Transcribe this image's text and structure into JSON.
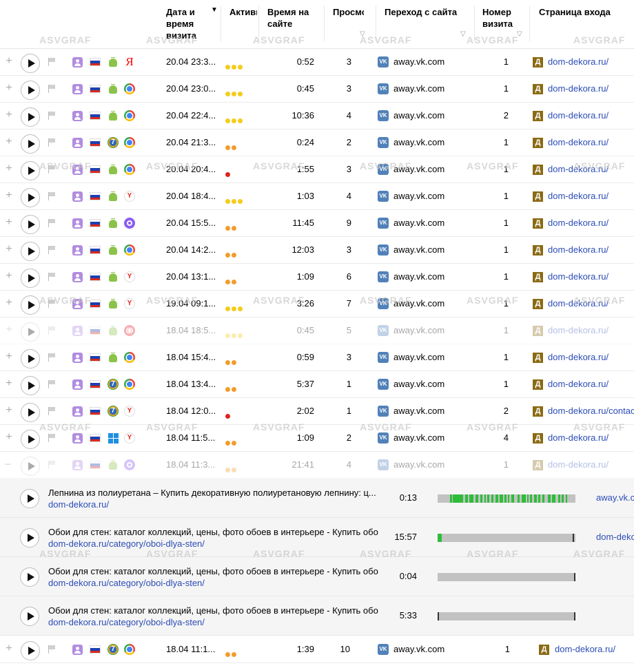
{
  "header": {
    "date": "Дата и время визита",
    "activity": "Активн",
    "duration": "Время на сайте",
    "views": "Просмо",
    "source": "Переход с сайта",
    "visit_number": "Номер визита",
    "entry_page": "Страница входа"
  },
  "watermark": "ASVGRAF",
  "colors": {
    "yellow_dot": "#f4cc1a",
    "orange_dot": "#f39c2a",
    "red_dot": "#e02020",
    "link": "#2b4cb6",
    "green_bar": "#2ebd3a"
  },
  "visits": [
    {
      "date": "20.04 23:3...",
      "dots": "yyy",
      "os": "android",
      "browser": "yandex-letter",
      "duration": "0:52",
      "views": "3",
      "source": "away.vk.com",
      "visit_no": "1",
      "entry": "dom-dekora.ru/",
      "faded": false
    },
    {
      "date": "20.04 23:0...",
      "dots": "yyy",
      "os": "android",
      "browser": "chrome",
      "duration": "0:45",
      "views": "3",
      "source": "away.vk.com",
      "visit_no": "1",
      "entry": "dom-dekora.ru/",
      "faded": false
    },
    {
      "date": "20.04 22:4...",
      "dots": "yyy",
      "os": "android",
      "browser": "chrome",
      "duration": "10:36",
      "views": "4",
      "source": "away.vk.com",
      "visit_no": "2",
      "entry": "dom-dekora.ru/",
      "faded": false
    },
    {
      "date": "20.04 21:3...",
      "dots": "oo",
      "os": "win7",
      "browser": "chrome",
      "duration": "0:24",
      "views": "2",
      "source": "away.vk.com",
      "visit_no": "1",
      "entry": "dom-dekora.ru/",
      "faded": false
    },
    {
      "date": "20.04 20:4...",
      "dots": "r",
      "os": "android",
      "browser": "chrome",
      "duration": "1:55",
      "views": "3",
      "source": "away.vk.com",
      "visit_no": "1",
      "entry": "dom-dekora.ru/",
      "faded": false
    },
    {
      "date": "20.04 18:4...",
      "dots": "yyy",
      "os": "android",
      "browser": "yandex",
      "duration": "1:03",
      "views": "4",
      "source": "away.vk.com",
      "visit_no": "1",
      "entry": "dom-dekora.ru/",
      "faded": false
    },
    {
      "date": "20.04 15:5...",
      "dots": "oo",
      "os": "android",
      "browser": "alice",
      "duration": "11:45",
      "views": "9",
      "source": "away.vk.com",
      "visit_no": "1",
      "entry": "dom-dekora.ru/",
      "faded": false
    },
    {
      "date": "20.04 14:2...",
      "dots": "oo",
      "os": "android",
      "browser": "chrome",
      "duration": "12:03",
      "views": "3",
      "source": "away.vk.com",
      "visit_no": "1",
      "entry": "dom-dekora.ru/",
      "faded": false
    },
    {
      "date": "20.04 13:1...",
      "dots": "oo",
      "os": "android",
      "browser": "yandex",
      "duration": "1:09",
      "views": "6",
      "source": "away.vk.com",
      "visit_no": "1",
      "entry": "dom-dekora.ru/",
      "faded": false
    },
    {
      "date": "19.04 09:1...",
      "dots": "yyy",
      "os": "android",
      "browser": "yandex",
      "duration": "3:26",
      "views": "7",
      "source": "away.vk.com",
      "visit_no": "1",
      "entry": "dom-dekora.ru/",
      "faded": false
    },
    {
      "date": "18.04 18:5...",
      "dots": "yyy",
      "os": "android",
      "browser": "opera",
      "duration": "0:45",
      "views": "5",
      "source": "away.vk.com",
      "visit_no": "1",
      "entry": "dom-dekora.ru/",
      "faded": true
    },
    {
      "date": "18.04 15:4...",
      "dots": "oo",
      "os": "android",
      "browser": "chrome",
      "duration": "0:59",
      "views": "3",
      "source": "away.vk.com",
      "visit_no": "1",
      "entry": "dom-dekora.ru/",
      "faded": false
    },
    {
      "date": "18.04 13:4...",
      "dots": "oo",
      "os": "win7",
      "browser": "chrome",
      "duration": "5:37",
      "views": "1",
      "source": "away.vk.com",
      "visit_no": "1",
      "entry": "dom-dekora.ru/",
      "faded": false
    },
    {
      "date": "18.04 12:0...",
      "dots": "r",
      "os": "win7",
      "browser": "yandex",
      "duration": "2:02",
      "views": "1",
      "source": "away.vk.com",
      "visit_no": "2",
      "entry": "dom-dekora.ru/contac",
      "faded": false
    },
    {
      "date": "18.04 11:5...",
      "dots": "oo",
      "os": "win10",
      "browser": "yandex",
      "duration": "1:09",
      "views": "2",
      "source": "away.vk.com",
      "visit_no": "4",
      "entry": "dom-dekora.ru/",
      "faded": false
    },
    {
      "date": "18.04 11:3...",
      "dots": "oo",
      "os": "android",
      "browser": "alice",
      "duration": "21:41",
      "views": "4",
      "source": "away.vk.com",
      "visit_no": "1",
      "entry": "dom-dekora.ru/",
      "faded": true,
      "expanded": true
    }
  ],
  "subpages": [
    {
      "title": "Лепнина из полиуретана – Купить декоративную полиуретановую лепнину: ц...",
      "url": "dom-dekora.ru/",
      "time": "0:13",
      "source": "away.vk.c"
    },
    {
      "title": "Обои для стен: каталог коллекций, цены, фото обоев в интерьере - Купить обо...",
      "url": "dom-dekora.ru/category/oboi-dlya-sten/",
      "time": "15:57",
      "source": "dom-deko"
    },
    {
      "title": "Обои для стен: каталог коллекций, цены, фото обоев в интерьере - Купить обо...",
      "url": "dom-dekora.ru/category/oboi-dlya-sten/",
      "time": "0:04",
      "source": ""
    },
    {
      "title": "Обои для стен: каталог коллекций, цены, фото обоев в интерьере - Купить обо...",
      "url": "dom-dekora.ru/category/oboi-dlya-sten/",
      "time": "5:33",
      "source": ""
    }
  ],
  "last_visit": {
    "date": "18.04 11:1...",
    "dots": "oo",
    "os": "win7",
    "browser": "chrome",
    "duration": "1:39",
    "views": "10",
    "source": "away.vk.com",
    "visit_no": "1",
    "entry": "dom-dekora.ru/"
  }
}
